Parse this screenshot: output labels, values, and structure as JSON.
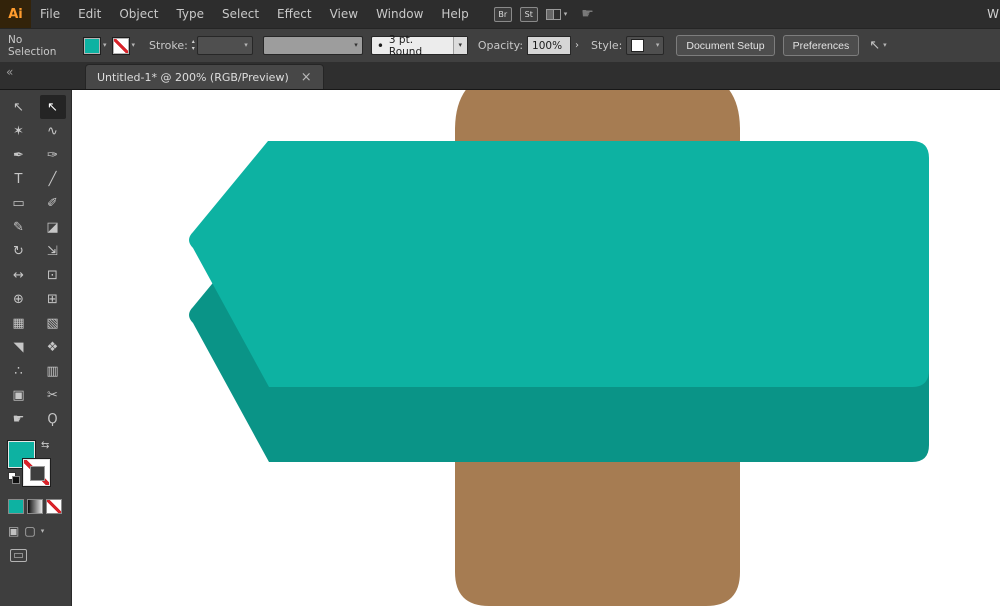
{
  "colors": {
    "teal": "#0db2a2",
    "teal_dark": "#0a9487",
    "brown": "#a67c52",
    "red_slash": "#d8232a",
    "artboard": "#ffffff"
  },
  "styles": {
    "teal_bg": "background:#0db2a2"
  },
  "menu_bar": {
    "logo": "Ai",
    "items": [
      "File",
      "Edit",
      "Object",
      "Type",
      "Select",
      "Effect",
      "View",
      "Window",
      "Help"
    ],
    "bridge_badge": "Br",
    "stock_badge": "St",
    "arrange_chevron": "▾",
    "gesture_glyph": "☛",
    "workspace_truncated": "W"
  },
  "control_bar": {
    "selection_status": "No Selection",
    "fill_chevron": "▾",
    "stroke_chevron": "▾",
    "stroke_label": "Stroke:",
    "spinner_up": "▴",
    "spinner_down": "▾",
    "weight_chevron": "▾",
    "profile_chevron": "▾",
    "brush_bullet": "•",
    "brush_value": "3 pt. Round",
    "brush_chevron": "▾",
    "opacity_label": "Opacity:",
    "opacity_value": "100%",
    "opacity_expand": "›",
    "style_label": "Style:",
    "style_chevron": "▾",
    "document_setup": "Document Setup",
    "preferences": "Preferences",
    "select_similar_glyph": "↖",
    "select_similar_chevron": "▾"
  },
  "tab_bar": {
    "collapse": "«",
    "title": "Untitled-1* @ 200% (RGB/Preview)",
    "close": "×"
  },
  "tools": [
    {
      "name": "selection-tool",
      "glyph": "↖"
    },
    {
      "name": "direct-selection-tool",
      "glyph": "↖",
      "selected": true
    },
    {
      "name": "magic-wand-tool",
      "glyph": "✶"
    },
    {
      "name": "lasso-tool",
      "glyph": "∿"
    },
    {
      "name": "pen-tool",
      "glyph": "✒"
    },
    {
      "name": "curvature-tool",
      "glyph": "✑"
    },
    {
      "name": "type-tool",
      "glyph": "T"
    },
    {
      "name": "line-segment-tool",
      "glyph": "╱"
    },
    {
      "name": "rectangle-tool",
      "glyph": "▭"
    },
    {
      "name": "paintbrush-tool",
      "glyph": "✐"
    },
    {
      "name": "pencil-tool",
      "glyph": "✎"
    },
    {
      "name": "eraser-tool",
      "glyph": "◪"
    },
    {
      "name": "rotate-tool",
      "glyph": "↻"
    },
    {
      "name": "scale-tool",
      "glyph": "⇲"
    },
    {
      "name": "width-tool",
      "glyph": "↔"
    },
    {
      "name": "free-transform-tool",
      "glyph": "⊡"
    },
    {
      "name": "shape-builder-tool",
      "glyph": "⊕"
    },
    {
      "name": "perspective-grid-tool",
      "glyph": "⊞"
    },
    {
      "name": "mesh-tool",
      "glyph": "▦"
    },
    {
      "name": "gradient-tool",
      "glyph": "▧"
    },
    {
      "name": "eyedropper-tool",
      "glyph": "◥"
    },
    {
      "name": "blend-tool",
      "glyph": "❖"
    },
    {
      "name": "symbol-sprayer-tool",
      "glyph": "∴"
    },
    {
      "name": "column-graph-tool",
      "glyph": "▥"
    },
    {
      "name": "artboard-tool",
      "glyph": "▣"
    },
    {
      "name": "slice-tool",
      "glyph": "✂"
    },
    {
      "name": "hand-tool",
      "glyph": "☛"
    },
    {
      "name": "zoom-tool",
      "glyph": "Ϙ"
    }
  ],
  "toolbar_bottom": {
    "swap_glyph": "⇆",
    "draw_normal_glyph": "▣",
    "draw_behind_glyph": "▢",
    "draw_chevron": "▾"
  },
  "canvas": {
    "artboard_background": "#ffffff",
    "shapes": [
      {
        "name": "signpost-pole",
        "fill": "#a67c52"
      },
      {
        "name": "banner-extrusion",
        "fill": "#0a9487"
      },
      {
        "name": "banner-front",
        "fill": "#0db2a2"
      }
    ]
  }
}
